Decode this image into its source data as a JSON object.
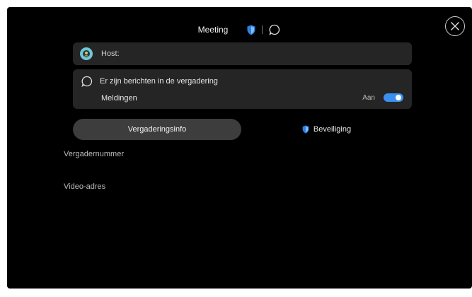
{
  "header": {
    "title": "Meeting",
    "shield_icon": "shield-icon",
    "chat_icon": "chat-bubble-icon",
    "close_icon": "close-icon"
  },
  "host": {
    "label": "Host:",
    "avatar_icon": "avatar-icon"
  },
  "messages": {
    "text": "Er zijn berichten in de vergadering",
    "notifications_label": "Meldingen",
    "toggle_state": "Aan",
    "toggle_on": true
  },
  "tabs": [
    {
      "label": "Vergaderingsinfo",
      "active": true
    },
    {
      "label": "Beveiliging",
      "active": false
    }
  ],
  "info": {
    "meeting_number_label": "Vergadernummer",
    "video_address_label": "Video-adres"
  },
  "colors": {
    "background": "#000000",
    "card": "#252525",
    "accent": "#3a8ff0",
    "active_tab": "#3d3d3d"
  }
}
